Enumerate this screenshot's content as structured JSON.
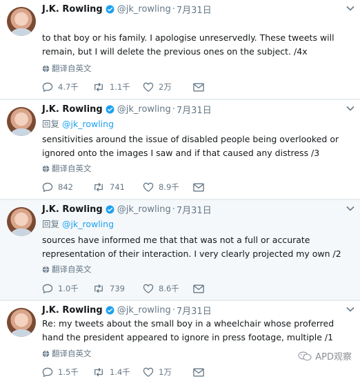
{
  "tweets": [
    {
      "name": "J.K. Rowling",
      "handle": "@jk_rowling",
      "separator": "·",
      "time": "7月31日",
      "replying_to": null,
      "text": "to that boy or his family. I apologise unreservedly. These tweets will remain, but I will delete the previous ones on the subject. /4x",
      "translate": "翻译自英文",
      "replies": "4.7千",
      "retweets": "1.1千",
      "likes": "2万"
    },
    {
      "name": "J.K. Rowling",
      "handle": "@jk_rowling",
      "separator": "·",
      "time": "7月31日",
      "replying_to": {
        "label": "回复",
        "mention": "@jk_rowling"
      },
      "text": "sensitivities around the issue of disabled people being overlooked or ignored onto the images I saw and if that caused any distress /3",
      "translate": "翻译自英文",
      "replies": "842",
      "retweets": "741",
      "likes": "8.9千"
    },
    {
      "name": "J.K. Rowling",
      "handle": "@jk_rowling",
      "separator": "·",
      "time": "7月31日",
      "replying_to": {
        "label": "回复",
        "mention": "@jk_rowling"
      },
      "text": "sources have informed me that that was not a full or accurate representation of their interaction. I very clearly projected my own /2",
      "translate": "翻译自英文",
      "replies": "1.0千",
      "retweets": "739",
      "likes": "8.6千"
    },
    {
      "name": "J.K. Rowling",
      "handle": "@jk_rowling",
      "separator": "·",
      "time": "7月31日",
      "replying_to": null,
      "text": "Re: my tweets about the small boy in a wheelchair whose proferred hand the president appeared to ignore in press footage, multiple /1",
      "translate": "翻译自英文",
      "replies": "1.5千",
      "retweets": "1.4千",
      "likes": "1万"
    }
  ],
  "watermark": "APD观察",
  "colors": {
    "accent": "#1da1f2",
    "muted": "#657786",
    "text": "#14171a",
    "divider": "#e6ecf0"
  }
}
